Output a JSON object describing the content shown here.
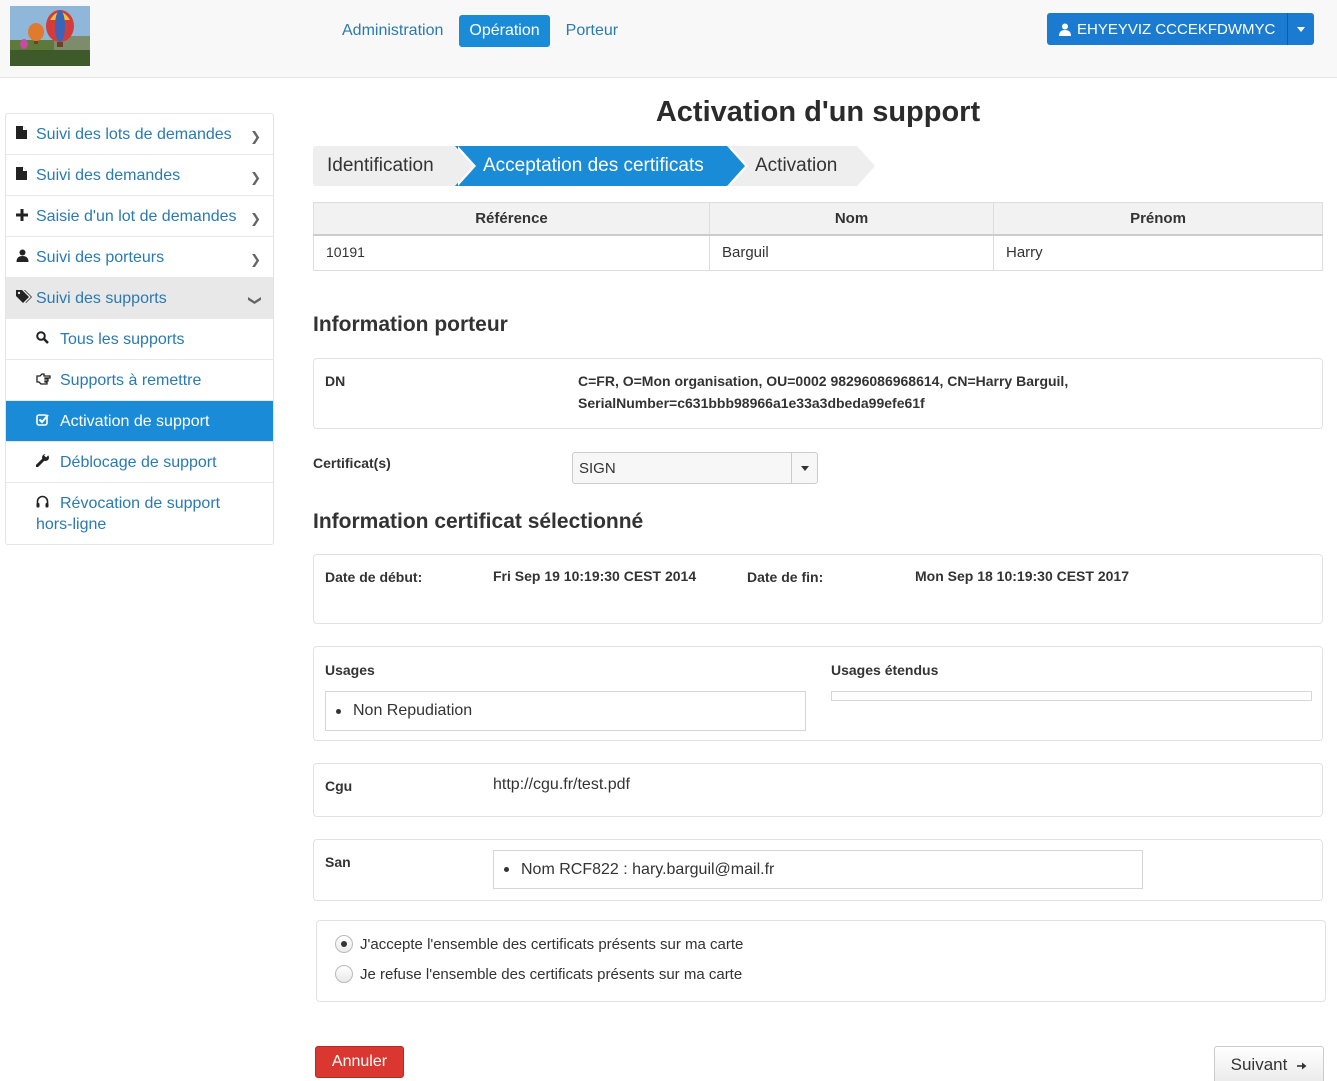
{
  "header": {
    "nav": [
      "Administration",
      "Opération",
      "Porteur"
    ],
    "active_nav": "Opération",
    "user_name": "EHYEYVIZ CCCEKFDWMYC"
  },
  "sidebar": {
    "items": [
      {
        "label": "Suivi des lots de demandes",
        "icon": "file-icon"
      },
      {
        "label": "Suivi des demandes",
        "icon": "file-icon"
      },
      {
        "label": "Saisie d'un lot de demandes",
        "icon": "plus-icon"
      },
      {
        "label": "Suivi des porteurs",
        "icon": "user-icon"
      },
      {
        "label": "Suivi des supports",
        "icon": "tags-icon"
      }
    ],
    "subitems": [
      {
        "label": "Tous les supports",
        "icon": "search-icon"
      },
      {
        "label": "Supports à remettre",
        "icon": "hand-right-icon"
      },
      {
        "label": "Activation de support",
        "icon": "check-icon"
      },
      {
        "label": "Déblocage de support",
        "icon": "wrench-icon"
      },
      {
        "label": "Révocation de support hors-ligne",
        "icon": "headphones-icon"
      }
    ]
  },
  "main": {
    "title": "Activation d'un support",
    "steps": [
      "Identification",
      "Acceptation des certificats",
      "Activation"
    ],
    "active_step": 1,
    "table": {
      "headers": [
        "Référence",
        "Nom",
        "Prénom"
      ],
      "row": [
        "10191",
        "Barguil",
        "Harry"
      ]
    },
    "porteur_title": "Information porteur",
    "dn_label": "DN",
    "dn_value": "C=FR, O=Mon organisation, OU=0002 98296086968614, CN=Harry Barguil, SerialNumber=c631bbb98966a1e33a3dbeda99efe61f",
    "cert_label": "Certificat(s)",
    "cert_selected": "SIGN",
    "cert_title": "Information certificat sélectionné",
    "start_label": "Date de début:",
    "start_value": "Fri Sep 19 10:19:30 CEST 2014",
    "end_label": "Date de fin:",
    "end_value": "Mon Sep 18 10:19:30 CEST 2017",
    "usages_label": "Usages",
    "usages": [
      "Non Repudiation"
    ],
    "ext_usages_label": "Usages étendus",
    "cgu_label": "Cgu",
    "cgu_value": "http://cgu.fr/test.pdf",
    "san_label": "San",
    "san_value": "Nom RCF822 : hary.barguil@mail.fr",
    "accept_label": "J'accepte l'ensemble des certificats présents sur ma carte",
    "refuse_label": "Je refuse l'ensemble des certificats présents sur ma carte",
    "accepted": true
  },
  "footer": {
    "cancel_label": "Annuler",
    "next_label": "Suivant"
  },
  "colors": {
    "primary": "#1a8bd6",
    "danger": "#d9372f",
    "link": "#2a7ab0"
  }
}
